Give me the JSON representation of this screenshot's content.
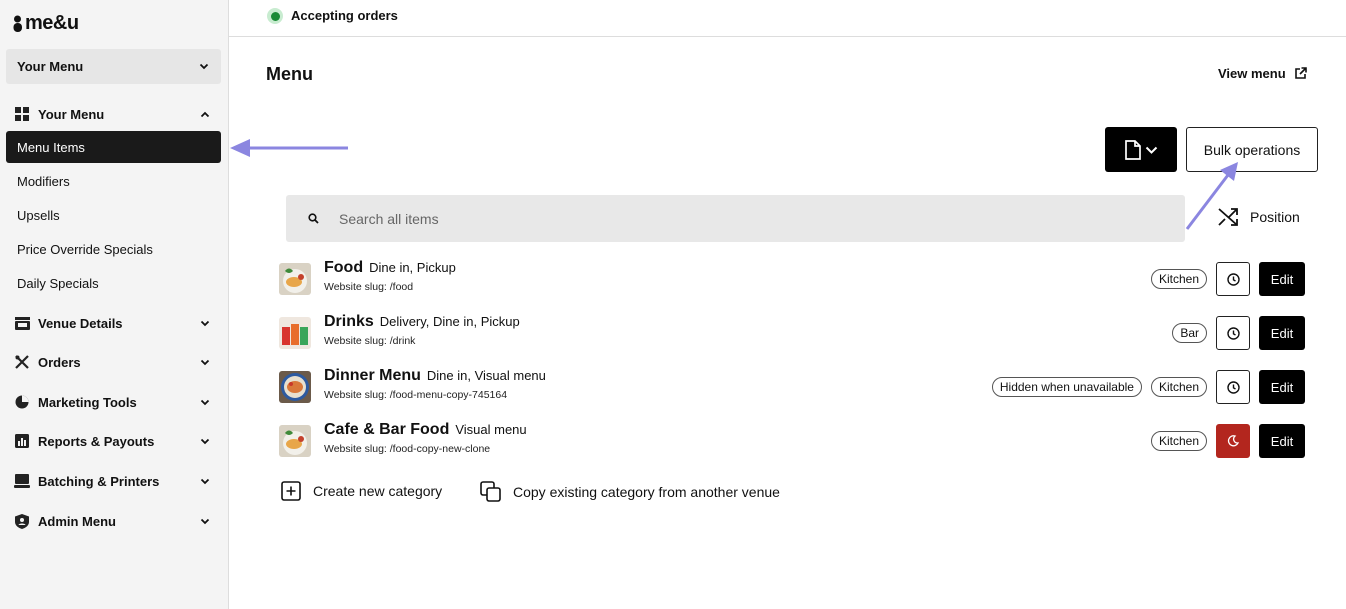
{
  "app": {
    "logo_text": "me&u"
  },
  "sidebar": {
    "venue_select": "Your Menu",
    "groups": [
      {
        "label": "Your Menu",
        "icon": "grid-icon",
        "expanded": true
      },
      {
        "label": "Venue Details",
        "icon": "store-icon"
      },
      {
        "label": "Orders",
        "icon": "utensils-icon"
      },
      {
        "label": "Marketing Tools",
        "icon": "pie-chart-icon"
      },
      {
        "label": "Reports & Payouts",
        "icon": "bar-chart-icon"
      },
      {
        "label": "Batching & Printers",
        "icon": "laptop-icon"
      },
      {
        "label": "Admin Menu",
        "icon": "shield-user-icon"
      }
    ],
    "sub_items": [
      {
        "label": "Menu Items",
        "active": true
      },
      {
        "label": "Modifiers"
      },
      {
        "label": "Upsells"
      },
      {
        "label": "Price Override Specials"
      },
      {
        "label": "Daily Specials"
      }
    ]
  },
  "topbar": {
    "status": "Accepting orders",
    "status_color": "#1a8a36"
  },
  "main": {
    "title": "Menu",
    "view_menu": "View menu",
    "bulk_operations": "Bulk operations",
    "search_placeholder": "Search all items",
    "sort_label": "Position",
    "categories": [
      {
        "name": "Food",
        "types": "Dine in, Pickup",
        "slug": "Website slug: /food",
        "tags": [
          "Kitchen"
        ],
        "schedule_state": "normal"
      },
      {
        "name": "Drinks",
        "types": "Delivery, Dine in, Pickup",
        "slug": "Website slug: /drink",
        "tags": [
          "Bar"
        ],
        "schedule_state": "normal"
      },
      {
        "name": "Dinner Menu",
        "types": "Dine in, Visual menu",
        "slug": "Website slug: /food-menu-copy-745164",
        "tags": [
          "Hidden when unavailable",
          "Kitchen"
        ],
        "schedule_state": "normal"
      },
      {
        "name": "Cafe & Bar Food",
        "types": "Visual menu",
        "slug": "Website slug: /food-copy-new-clone",
        "tags": [
          "Kitchen"
        ],
        "schedule_state": "unavailable"
      }
    ],
    "edit_label": "Edit",
    "create_category": "Create new category",
    "copy_category": "Copy existing category from another venue"
  },
  "colors": {
    "accent_arrow": "#8b86e0",
    "active_nav": "#1a1a1a",
    "unavailable_red": "#b3261e"
  }
}
